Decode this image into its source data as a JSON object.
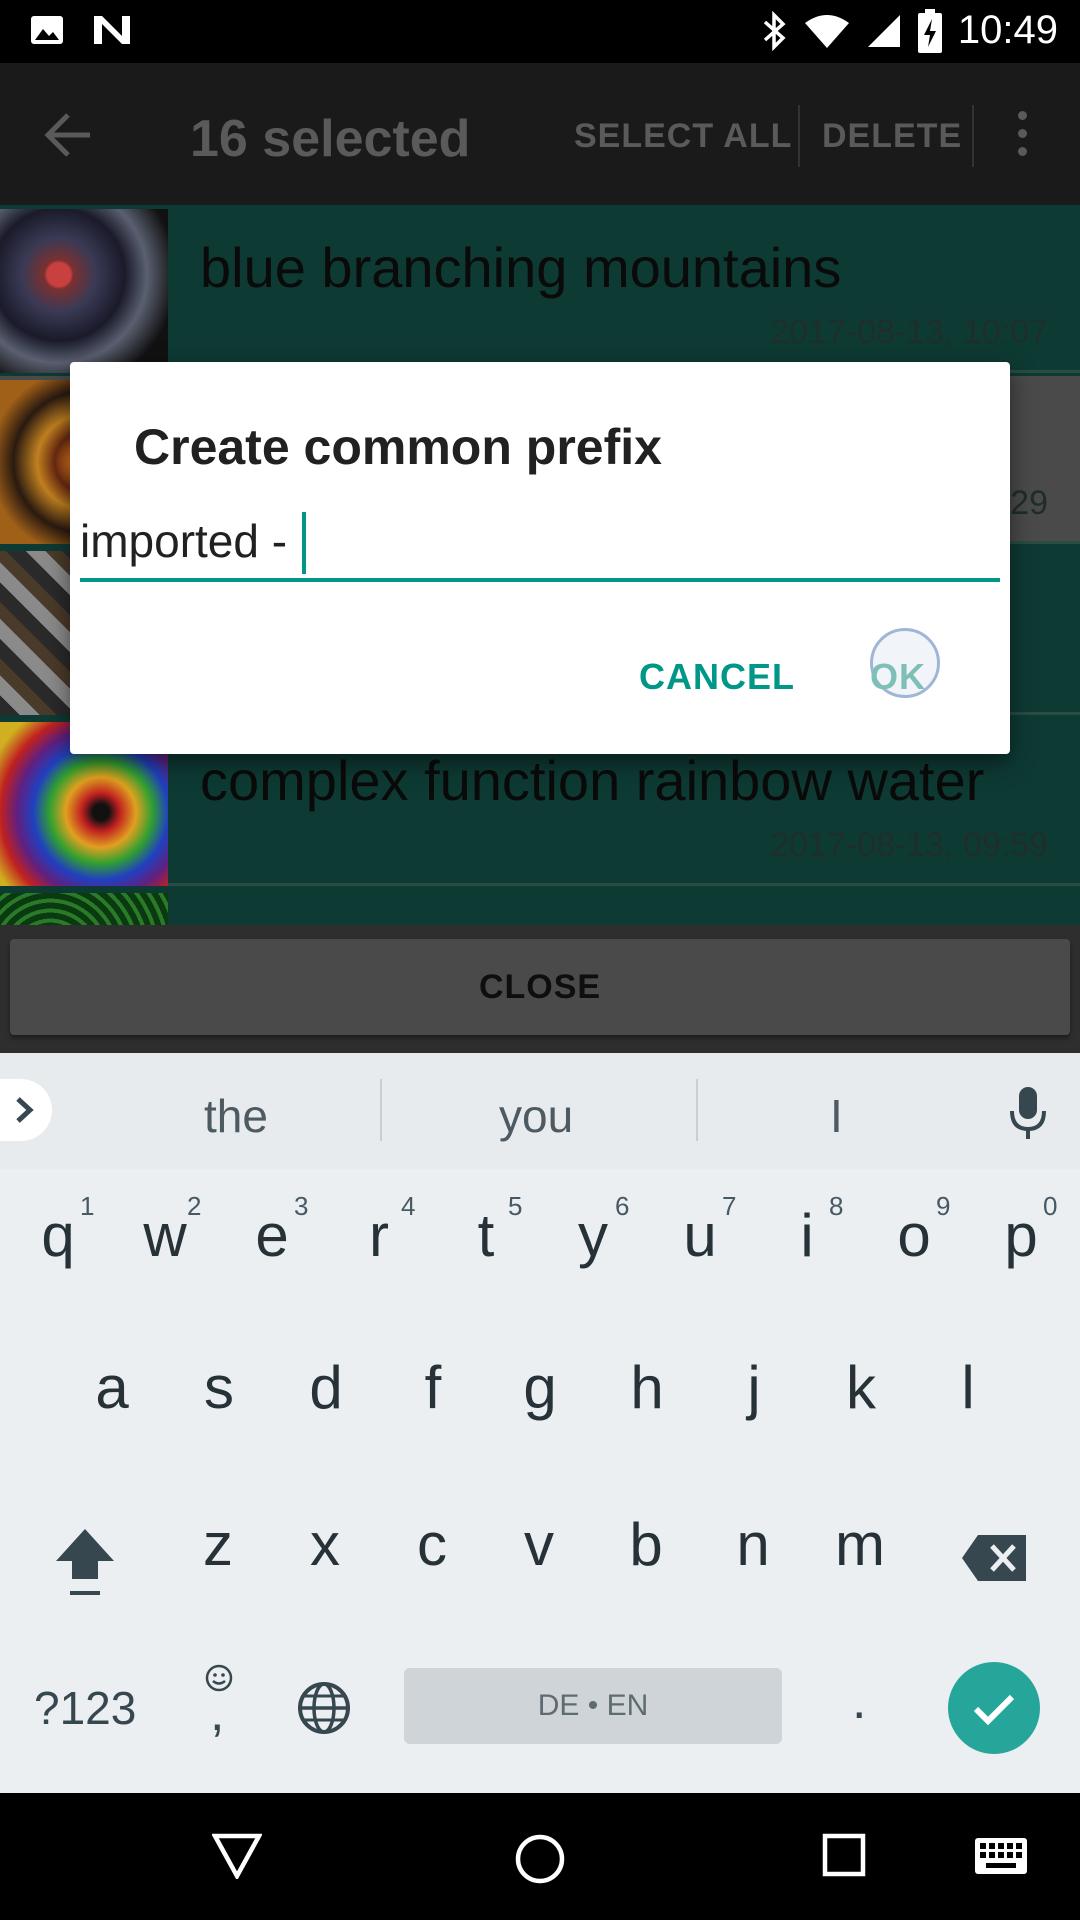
{
  "status_bar": {
    "time": "10:49",
    "icons": [
      "image-icon",
      "n-icon",
      "bluetooth-icon",
      "wifi-icon",
      "signal-icon",
      "battery-charging-icon"
    ]
  },
  "app_bar": {
    "title": "16 selected",
    "select_all": "SELECT ALL",
    "delete": "DELETE"
  },
  "list": {
    "items": [
      {
        "title": "blue branching mountains",
        "date": "2017-08-13, 10:07"
      },
      {
        "title": "",
        "date": "29"
      },
      {
        "title": "",
        "date": ""
      },
      {
        "title": "complex function rainbow water",
        "date": "2017-08-13, 09:59"
      }
    ]
  },
  "close_button": "CLOSE",
  "dialog": {
    "title": "Create common prefix",
    "input_value": "imported - ",
    "cancel": "CANCEL",
    "ok": "OK"
  },
  "keyboard": {
    "suggestions": [
      "the",
      "you",
      "I"
    ],
    "row1": [
      "q",
      "w",
      "e",
      "r",
      "t",
      "y",
      "u",
      "i",
      "o",
      "p"
    ],
    "row1_hints": [
      "1",
      "2",
      "3",
      "4",
      "5",
      "6",
      "7",
      "8",
      "9",
      "0"
    ],
    "row2": [
      "a",
      "s",
      "d",
      "f",
      "g",
      "h",
      "j",
      "k",
      "l"
    ],
    "row3": [
      "z",
      "x",
      "c",
      "v",
      "b",
      "n",
      "m"
    ],
    "symbols_key": "?123",
    "comma_key": ",",
    "space_label": "DE • EN",
    "period_key": "."
  },
  "colors": {
    "accent": "#009688",
    "list_bg": "#0e3a34",
    "appbar_bg": "#1a1a1a",
    "enter_key": "#26a69a"
  }
}
